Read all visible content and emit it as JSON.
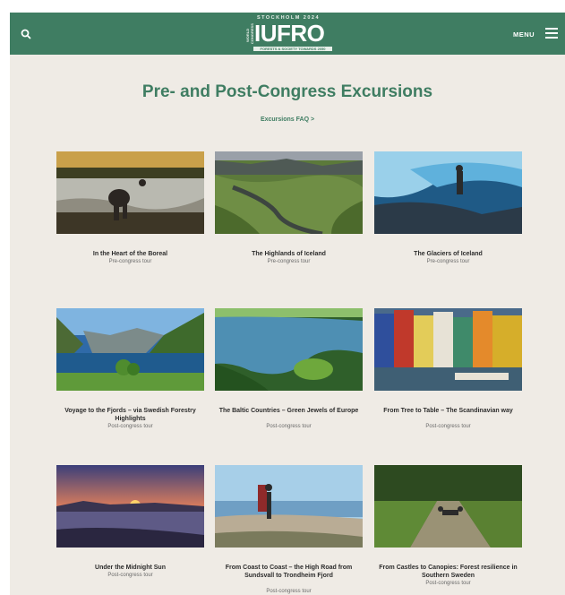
{
  "header": {
    "logo_word": "IUFRO",
    "logo_top": "STOCKHOLM 2024",
    "logo_side": "WORLD CONGRESS",
    "logo_bottom": "FORESTS & SOCIETY TOWARDS 2050",
    "menu_label": "MENU",
    "search_icon": "search-icon",
    "menu_icon": "hamburger-icon"
  },
  "page": {
    "title": "Pre- and Post-Congress Excursions",
    "faq_link": "Excursions FAQ >"
  },
  "colors": {
    "brand_green": "#3f7d62",
    "background": "#efebe5",
    "title_text": "#2c2c2c",
    "subtitle_text": "#6a6a6a"
  },
  "excursions": [
    {
      "title": "In the Heart of the Boreal",
      "subtitle": "Pre-congress tour"
    },
    {
      "title": "The Highlands of Iceland",
      "subtitle": "Pre-congress tour"
    },
    {
      "title": "The Glaciers of Iceland",
      "subtitle": "Pre-congress tour"
    },
    {
      "title": "Voyage to the Fjords – via Swedish Forestry Highlights",
      "subtitle": "Post-congress tour"
    },
    {
      "title": "The Baltic Countries – Green Jewels of Europe",
      "subtitle": "Post-congress tour"
    },
    {
      "title": "From Tree to Table – The Scandinavian way",
      "subtitle": "Post-congress tour"
    },
    {
      "title": "Under the Midnight Sun",
      "subtitle": "Post-congress tour"
    },
    {
      "title": "From Coast to Coast – the High Road from Sundsvall to Trondheim Fjord",
      "subtitle": "Post-congress tour"
    },
    {
      "title": "From Castles to Canopies: Forest resilience in Southern Sweden",
      "subtitle": "Post-congress tour"
    }
  ]
}
